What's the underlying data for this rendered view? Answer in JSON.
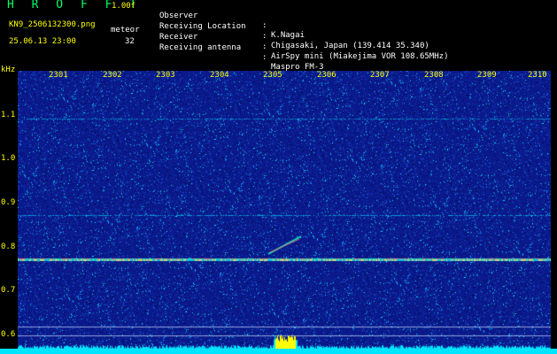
{
  "header": {
    "app_title": "H R O F F T",
    "version": "1.00f",
    "filename": "KN9_2506132300.png",
    "meteor_label": "meteor",
    "datetime": "25.06.13 23:00",
    "meteor_count": "32",
    "info": [
      {
        "key": "Observer",
        "value": "K.Nagai"
      },
      {
        "key": "Receiving Location",
        "value": "Chigasaki, Japan (139.414 35.340)"
      },
      {
        "key": "Receiver",
        "value": "AirSpy mini (Miakejima VOR 108.65MHz)"
      },
      {
        "key": "Receiving antenna",
        "value": "Maspro FM-3"
      }
    ]
  },
  "axis": {
    "unit": "kHz",
    "y_ticks": [
      "1.1",
      "1.0",
      "0.9",
      "0.8",
      "0.7",
      "0.6"
    ],
    "x_ticks": [
      "2301",
      "2302",
      "2303",
      "2304",
      "2305",
      "2306",
      "2307",
      "2308",
      "2309",
      "2310"
    ]
  },
  "colors": {
    "background": "#0a1a8c",
    "label": "#ffff00",
    "signal": "#00e5ff"
  }
}
